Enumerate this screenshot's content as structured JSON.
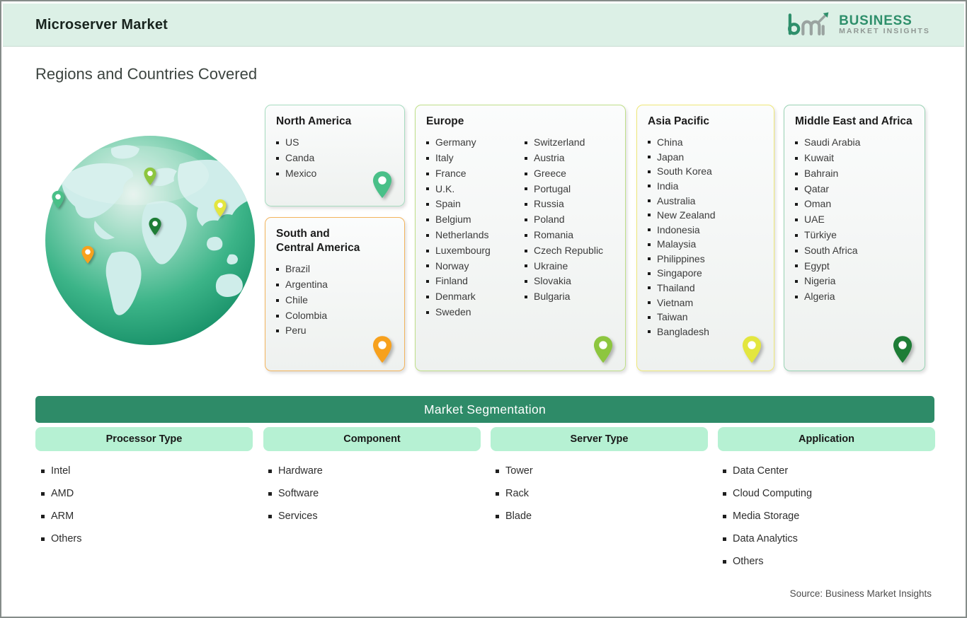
{
  "header": {
    "title": "Microserver Market",
    "logo": {
      "line1": "BUSINESS",
      "line2": "MARKET INSIGHTS"
    }
  },
  "page": {
    "heading": "Regions and Countries Covered",
    "source": "Source: Business Market Insights"
  },
  "regions": [
    {
      "name": "North America",
      "border": "#A7DCC0",
      "pin": "#49C088",
      "items": [
        "US",
        "Canda",
        "Mexico"
      ]
    },
    {
      "name": "South and Central America",
      "border": "#F3B45C",
      "pin": "#F7A11D",
      "items": [
        "Brazil",
        "Argentina",
        "Chile",
        "Colombia",
        "Peru"
      ]
    },
    {
      "name": "Europe",
      "border": "#BFDF89",
      "pin": "#8DC63F",
      "items": [
        "Germany",
        "Italy",
        "France",
        "U.K.",
        "Spain",
        "Belgium",
        "Netherlands",
        "Luxembourg",
        "Norway",
        "Finland",
        "Denmark",
        "Sweden",
        "Switzerland",
        "Austria",
        "Greece",
        "Portugal",
        "Russia",
        "Poland",
        "Romania",
        "Czech Republic",
        "Ukraine",
        "Slovakia",
        "Bulgaria"
      ]
    },
    {
      "name": "Asia Pacific",
      "border": "#EFE878",
      "pin": "#E3E63F",
      "items": [
        "China",
        "Japan",
        "South Korea",
        "India",
        "Australia",
        "New Zealand",
        "Indonesia",
        "Malaysia",
        "Philippines",
        "Singapore",
        "Thailand",
        "Vietnam",
        "Taiwan",
        "Bangladesh"
      ]
    },
    {
      "name": "Middle East and Africa",
      "border": "#9AD3B5",
      "pin": "#1E7D36",
      "items": [
        "Saudi Arabia",
        "Kuwait",
        "Bahrain",
        "Qatar",
        "Oman",
        "UAE",
        "Türkiye",
        "South Africa",
        "Egypt",
        "Nigeria",
        "Algeria"
      ]
    }
  ],
  "segmentation": {
    "title": "Market Segmentation",
    "columns": [
      {
        "header": "Processor Type",
        "items": [
          "Intel",
          "AMD",
          "ARM",
          "Others"
        ]
      },
      {
        "header": "Component",
        "items": [
          "Hardware",
          "Software",
          "Services"
        ]
      },
      {
        "header": "Server Type",
        "items": [
          "Tower",
          "Rack",
          "Blade"
        ]
      },
      {
        "header": "Application",
        "items": [
          "Data Center",
          "Cloud Computing",
          "Media Storage",
          "Data Analytics",
          "Others"
        ]
      }
    ]
  },
  "theme": {
    "header_band": "#DCF0E6",
    "banner_green": "#2E8B68",
    "pill_mint": "#B6F1D3",
    "logo_green": "#2E8F6B",
    "logo_gray": "#8F9793",
    "globe_ocean": "#2FA97E",
    "globe_land": "#CFEDEA"
  }
}
